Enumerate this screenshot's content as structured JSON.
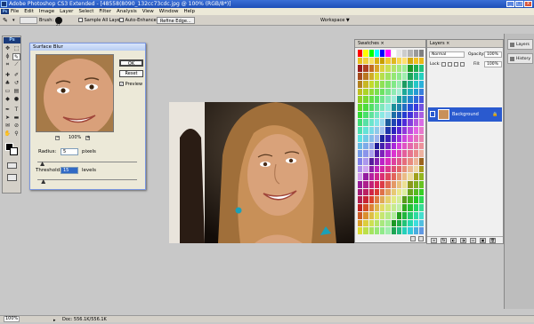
{
  "window": {
    "title": "Adobe Photoshop CS3 Extended - [48558(8090_132cc73cdc.jpg @ 100% (RGB/8*)]",
    "controls": [
      "_",
      "□",
      "x"
    ]
  },
  "menu": {
    "logo": "Ps",
    "items": [
      "File",
      "Edit",
      "Image",
      "Layer",
      "Select",
      "Filter",
      "Analysis",
      "View",
      "Window",
      "Help"
    ]
  },
  "options": {
    "brush_label": "Brush:",
    "brush_size": "27",
    "sample_all_layers": "Sample All Layers",
    "auto_enhance": "Auto-Enhance",
    "refine_edge": "Refine Edge...",
    "workspace": "Workspace ▼"
  },
  "toolbox": {
    "logo": "Ps"
  },
  "dialog": {
    "title": "Surface Blur",
    "ok": "OK",
    "reset": "Reset",
    "preview_label": "Preview",
    "preview_checked": true,
    "zoom": "100%",
    "zoom_minus": "−",
    "zoom_plus": "+",
    "radius_label": "Radius:",
    "radius_value": "5",
    "radius_unit": "pixels",
    "threshold_label": "Threshold:",
    "threshold_value": "15",
    "threshold_unit": "levels",
    "radius_fraction": 0.05,
    "threshold_fraction": 0.06
  },
  "swatches": {
    "tab": "Swatches ×",
    "colors": [
      "#ff0000",
      "#ffff00",
      "#00ff00",
      "#00ffff",
      "#0000ff",
      "#ff00ff",
      "#ffffff",
      "#e6e6e6",
      "#cccccc",
      "#b3b3b3",
      "#999999",
      "#808080",
      "#e8c020",
      "#f0d040",
      "#f8e060",
      "#d8b010",
      "#c8a000",
      "#f0c830",
      "#e0b820",
      "#f8d850",
      "#ffe070",
      "#d0a810",
      "#f0c020",
      "#e8b818"
    ]
  },
  "layers": {
    "tab": "Layers ×",
    "blend_mode": "Normal",
    "opacity_label": "Opacity:",
    "opacity_value": "100%",
    "lock_label": "Lock:",
    "fill_label": "Fill:",
    "fill_value": "100%",
    "layer_name": "Background",
    "footer_icons": [
      "∞",
      "fx",
      "◐",
      "◑",
      "▭",
      "▣",
      "🗑"
    ]
  },
  "dock": {
    "items": [
      "Layers",
      "History"
    ]
  },
  "status": {
    "zoom": "100%",
    "doc": "Doc: 556.1K/556.1K"
  }
}
